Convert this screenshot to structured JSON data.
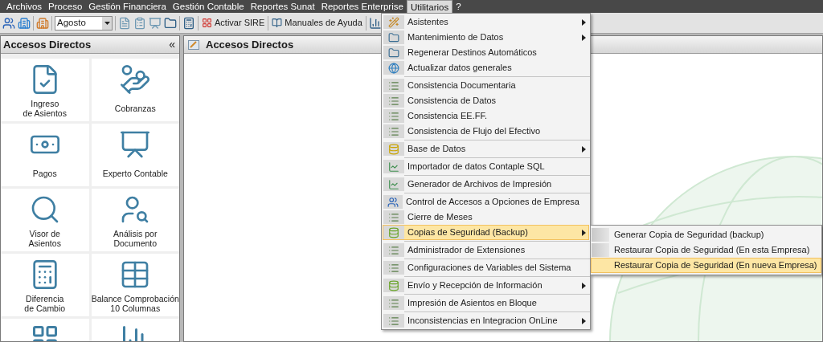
{
  "menu_bar": [
    {
      "label": "Archivos",
      "selected": false
    },
    {
      "label": "Proceso",
      "selected": false
    },
    {
      "label": "Gestión Financiera",
      "selected": false
    },
    {
      "label": "Gestión Contable",
      "selected": false
    },
    {
      "label": "Reportes Sunat",
      "selected": false
    },
    {
      "label": "Reportes Enterprise",
      "selected": false
    },
    {
      "label": "Utilitarios",
      "selected": true
    },
    {
      "label": "?",
      "selected": false
    }
  ],
  "toolbar": {
    "month": "Agosto",
    "buttons": [
      "Activar SIRE",
      "Manuales de Ayuda"
    ]
  },
  "shortcuts_panel": {
    "title": "Accesos Directos",
    "collapse_glyph": "«",
    "tiles": [
      {
        "lines": [
          "Ingreso",
          "de Asientos"
        ]
      },
      {
        "lines": [
          "Cobranzas"
        ]
      },
      {
        "lines": [
          "Pagos"
        ]
      },
      {
        "lines": [
          "Experto Contable"
        ]
      },
      {
        "lines": [
          "Visor de",
          "Asientos"
        ]
      },
      {
        "lines": [
          "Análisis por",
          "Documento"
        ]
      },
      {
        "lines": [
          "Diferencia",
          "de Cambio"
        ]
      },
      {
        "lines": [
          "Balance Comprobación",
          "10 Columnas"
        ]
      }
    ]
  },
  "main_panel": {
    "title": "Accesos Directos"
  },
  "menu": {
    "groups": [
      {
        "items": [
          {
            "label": "Asistentes",
            "submenu": true,
            "selected": false
          },
          {
            "label": "Mantenimiento de Datos",
            "submenu": true,
            "selected": false
          },
          {
            "label": "Regenerar Destinos Automáticos",
            "submenu": false,
            "selected": false
          },
          {
            "label": "Actualizar datos generales",
            "submenu": false,
            "selected": false
          }
        ]
      },
      {
        "items": [
          {
            "label": "Consistencia Documentaria",
            "submenu": false,
            "selected": false
          },
          {
            "label": "Consistencia de Datos",
            "submenu": false,
            "selected": false
          },
          {
            "label": "Consistencia EE.FF.",
            "submenu": false,
            "selected": false
          },
          {
            "label": "Consistencia de Flujo del Efectivo",
            "submenu": false,
            "selected": false
          }
        ]
      },
      {
        "items": [
          {
            "label": "Base de Datos",
            "submenu": true,
            "selected": false
          }
        ]
      },
      {
        "items": [
          {
            "label": "Importador de datos Contaple SQL",
            "submenu": false,
            "selected": false
          }
        ]
      },
      {
        "items": [
          {
            "label": "Generador de Archivos de Impresión",
            "submenu": false,
            "selected": false
          }
        ]
      },
      {
        "items": [
          {
            "label": "Control de Accesos a Opciones de Empresa",
            "submenu": false,
            "selected": false
          },
          {
            "label": "Cierre de Meses",
            "submenu": false,
            "selected": false
          },
          {
            "label": "Copias de Seguridad (Backup)",
            "submenu": true,
            "selected": true
          }
        ]
      },
      {
        "items": [
          {
            "label": "Administrador de Extensiones",
            "submenu": false,
            "selected": false
          }
        ]
      },
      {
        "items": [
          {
            "label": "Configuraciones de Variables del Sistema",
            "submenu": false,
            "selected": false
          }
        ]
      },
      {
        "items": [
          {
            "label": "Envío y Recepción de Información",
            "submenu": true,
            "selected": false
          }
        ]
      },
      {
        "items": [
          {
            "label": "Impresión de Asientos en Bloque",
            "submenu": false,
            "selected": false
          }
        ]
      },
      {
        "items": [
          {
            "label": "Inconsistencias en Integracion OnLine",
            "submenu": true,
            "selected": false
          }
        ]
      }
    ]
  },
  "submenu": {
    "items": [
      {
        "label": "Generar Copia de Seguridad (backup)",
        "selected": false
      },
      {
        "label": "Restaurar Copia de Seguridad (En esta Empresa)",
        "selected": false
      },
      {
        "label": "Restaurar Copia de Seguridad (En nueva Empresa)",
        "selected": true
      }
    ]
  }
}
